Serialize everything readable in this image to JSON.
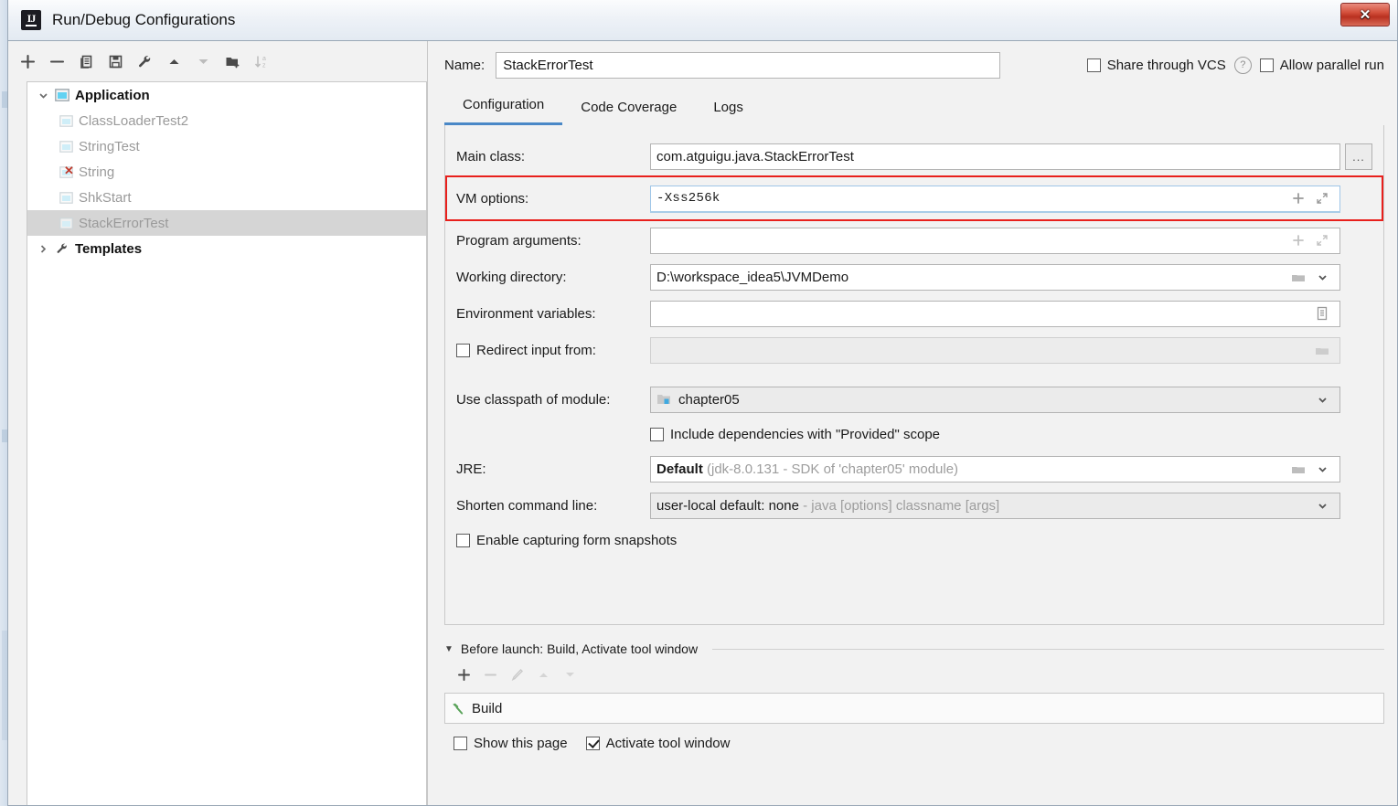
{
  "window": {
    "title": "Run/Debug Configurations",
    "app_icon": "intellij-idea-icon",
    "close_label": "✕"
  },
  "left_panel": {
    "toolbar": [
      {
        "name": "add-configuration-button",
        "icon": "plus-icon",
        "enabled": true
      },
      {
        "name": "remove-configuration-button",
        "icon": "minus-icon",
        "enabled": true
      },
      {
        "name": "copy-configuration-button",
        "icon": "copy-icon",
        "enabled": true
      },
      {
        "name": "save-configuration-button",
        "icon": "save-icon",
        "enabled": true
      },
      {
        "name": "edit-templates-button",
        "icon": "wrench-icon",
        "enabled": true
      },
      {
        "name": "move-up-button",
        "icon": "arrow-up-icon",
        "enabled": true
      },
      {
        "name": "move-down-button",
        "icon": "arrow-down-icon",
        "enabled": false
      },
      {
        "name": "create-folder-button",
        "icon": "folder-add-icon",
        "enabled": true
      },
      {
        "name": "sort-configurations-button",
        "icon": "sort-az-icon",
        "enabled": false
      }
    ],
    "tree": [
      {
        "label": "Application",
        "icon": "application-icon",
        "level": 0,
        "expanded": true,
        "bold": true,
        "selected": false,
        "error": false
      },
      {
        "label": "ClassLoaderTest2",
        "icon": "run-config-icon",
        "level": 1,
        "bold": false,
        "selected": false,
        "error": false
      },
      {
        "label": "StringTest",
        "icon": "run-config-icon",
        "level": 1,
        "bold": false,
        "selected": false,
        "error": false
      },
      {
        "label": "String",
        "icon": "run-config-icon",
        "level": 1,
        "bold": false,
        "selected": false,
        "error": true
      },
      {
        "label": "ShkStart",
        "icon": "run-config-icon",
        "level": 1,
        "bold": false,
        "selected": false,
        "error": false
      },
      {
        "label": "StackErrorTest",
        "icon": "run-config-icon",
        "level": 1,
        "bold": false,
        "selected": true,
        "error": false
      },
      {
        "label": "Templates",
        "icon": "wrench-icon",
        "level": 0,
        "expanded": false,
        "bold": true,
        "selected": false,
        "error": false
      }
    ]
  },
  "header": {
    "name_label": "Name:",
    "name_value": "StackErrorTest",
    "name_placeholder": "",
    "share_vcs_label": "Share through VCS",
    "share_vcs_checked": false,
    "help_icon": "question-mark-icon",
    "allow_parallel_label": "Allow parallel run",
    "allow_parallel_checked": false
  },
  "tabs": [
    {
      "label": "Configuration",
      "active": true
    },
    {
      "label": "Code Coverage",
      "active": false
    },
    {
      "label": "Logs",
      "active": false
    }
  ],
  "form": {
    "main_class": {
      "label": "Main class:",
      "value": "com.atguigu.java.StackErrorTest",
      "browse_label": "..."
    },
    "vm_options": {
      "label": "VM options:",
      "value": "-Xss256k",
      "highlighted": true,
      "highlight_color": "#e8201c",
      "expand_icon": "expand-icon",
      "macro_icon": "plus-icon"
    },
    "program_arguments": {
      "label": "Program arguments:",
      "value": "",
      "expand_icon": "expand-icon",
      "macro_icon": "plus-icon"
    },
    "working_directory": {
      "label": "Working directory:",
      "value": "D:\\workspace_idea5\\JVMDemo",
      "folder_icon": "folder-icon",
      "dropdown_icon": "chevron-down-icon"
    },
    "environment_variables": {
      "label": "Environment variables:",
      "value": "",
      "editor_icon": "list-editor-icon"
    },
    "redirect_input": {
      "label": "Redirect input from:",
      "checked": false,
      "value": "",
      "folder_icon": "folder-icon"
    },
    "classpath_module": {
      "label": "Use classpath of module:",
      "value": "chapter05",
      "module_icon": "module-icon",
      "dropdown_icon": "chevron-down-icon"
    },
    "include_provided": {
      "label": "Include dependencies with \"Provided\" scope",
      "checked": false
    },
    "jre": {
      "label": "JRE:",
      "value": "Default",
      "hint": "(jdk-8.0.131 - SDK of 'chapter05' module)",
      "folder_icon": "folder-icon",
      "dropdown_icon": "chevron-down-icon"
    },
    "shorten_command_line": {
      "label": "Shorten command line:",
      "value": "user-local default: none",
      "hint": "- java [options] classname [args]",
      "dropdown_icon": "chevron-down-icon"
    },
    "form_snapshots": {
      "label": "Enable capturing form snapshots",
      "checked": false
    }
  },
  "before_launch": {
    "header": "Before launch: Build, Activate tool window",
    "collapse_icon": "caret-down-icon",
    "toolbar": [
      {
        "name": "add-task-button",
        "icon": "plus-icon",
        "enabled": true
      },
      {
        "name": "remove-task-button",
        "icon": "minus-icon",
        "enabled": false
      },
      {
        "name": "edit-task-button",
        "icon": "pencil-icon",
        "enabled": false
      },
      {
        "name": "task-move-up-button",
        "icon": "arrow-up-icon",
        "enabled": false
      },
      {
        "name": "task-move-down-button",
        "icon": "arrow-down-icon",
        "enabled": false
      }
    ],
    "tasks": [
      {
        "label": "Build",
        "icon": "hammer-icon",
        "icon_color": "#5aa35a"
      }
    ],
    "show_this_page": {
      "label": "Show this page",
      "checked": false
    },
    "activate_tool_window": {
      "label": "Activate tool window",
      "checked": true
    }
  },
  "colors": {
    "accent": "#4a88c7",
    "highlight": "#e8201c",
    "selection": "#d5d5d5",
    "panel": "#f2f2f2"
  }
}
